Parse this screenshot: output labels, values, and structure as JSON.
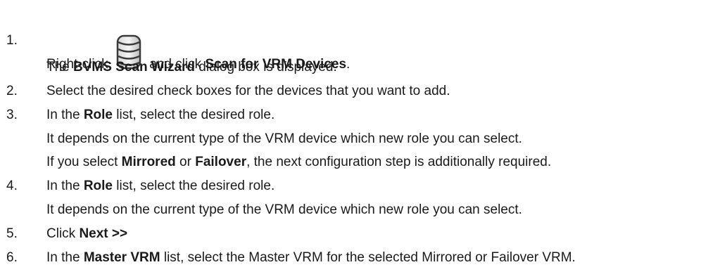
{
  "steps": [
    {
      "number": "1.",
      "line1": {
        "pre": "Right-click",
        "icon": "database-icon",
        "mid": "and click",
        "bold": "Scan for VRM Devices",
        "post": "."
      },
      "line2": {
        "pre": "The",
        "bold": "BVMS Scan Wizard",
        "post": "dialog box is displayed."
      }
    },
    {
      "number": "2.",
      "text": "Select the desired check boxes for the devices that you want to add."
    },
    {
      "number": "3.",
      "line1": {
        "pre": "In the",
        "bold": "Role",
        "post": "list, select the desired role."
      },
      "line2": "It depends on the current type of the VRM device which new role you can select.",
      "line3": {
        "pre": "If you select",
        "bold1": "Mirrored",
        "mid": "or",
        "bold2": "Failover",
        "post": ", the next configuration step is additionally required."
      }
    },
    {
      "number": "4.",
      "line1": {
        "pre": "In the",
        "bold": "Role",
        "post": "list, select the desired role."
      },
      "line2": "It depends on the current type of the VRM device which new role you can select."
    },
    {
      "number": "5.",
      "line1": {
        "pre": "Click",
        "bold": "Next >>"
      }
    },
    {
      "number": "6.",
      "line1": {
        "pre": "In the",
        "bold": "Master VRM",
        "post": "list, select the Master VRM for the selected Mirrored or Failover VRM."
      }
    }
  ]
}
